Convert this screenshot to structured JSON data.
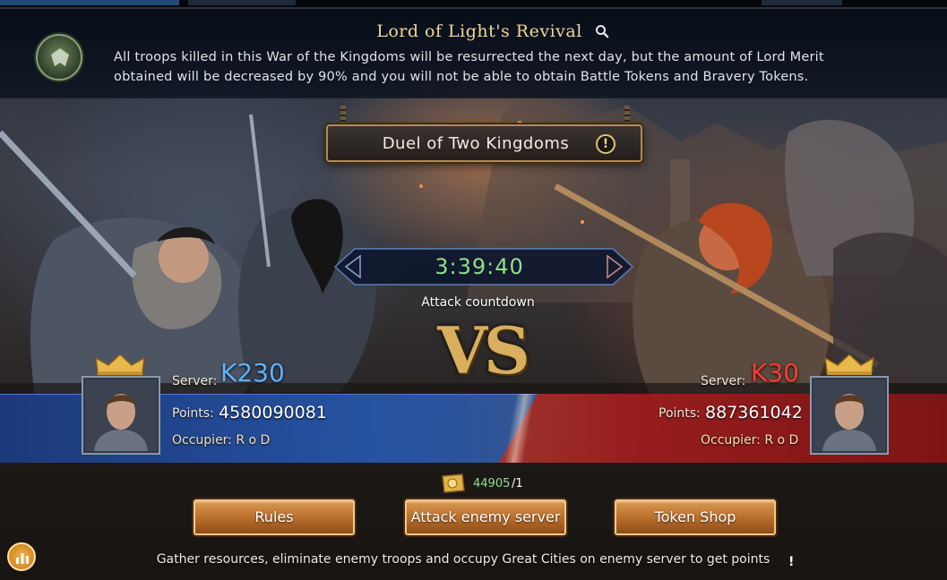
{
  "announcement": {
    "title": "Lord of Light's Revival",
    "text": "All troops killed in this War of the Kingdoms will be resurrected the next day, but the amount of Lord Merit obtained will be decreased by 90% and you will not be able to obtain Battle Tokens and Bravery Tokens."
  },
  "event": {
    "title": "Duel of Two Kingdoms",
    "info_glyph": "!"
  },
  "countdown": {
    "time": "3:39:40",
    "label": "Attack countdown"
  },
  "vs_text": "VS",
  "left_server": {
    "server_label": "Server:",
    "server_code": "K230",
    "points_label": "Points:",
    "points": "4580090081",
    "occupier": "Occupier: R o D",
    "code_color": "#5fb3ff"
  },
  "right_server": {
    "server_label": "Server:",
    "server_code": "K30",
    "points_label": "Points:",
    "points": "887361042",
    "occupier": "Occupier: R o D",
    "code_color": "#ff3b2f"
  },
  "tokens": {
    "count": "44905",
    "max": "/1"
  },
  "buttons": {
    "rules": "Rules",
    "attack": "Attack enemy server",
    "shop": "Token Shop"
  },
  "footer": {
    "text": "Gather resources, eliminate enemy troops and occupy Great Cities on enemy server to get points",
    "hint_glyph": "!"
  },
  "icons": {
    "emblem": "eagle-emblem-icon",
    "search": "search-icon",
    "info": "info-icon",
    "crown": "crown-icon",
    "token": "token-icon",
    "stats": "stats-icon"
  },
  "colors": {
    "title_gold": "#f3d79a",
    "timer_green": "#8fe08a",
    "blue_team": "#2656aa",
    "red_team": "#a01e1e",
    "button_orange": "#b66c2a"
  }
}
